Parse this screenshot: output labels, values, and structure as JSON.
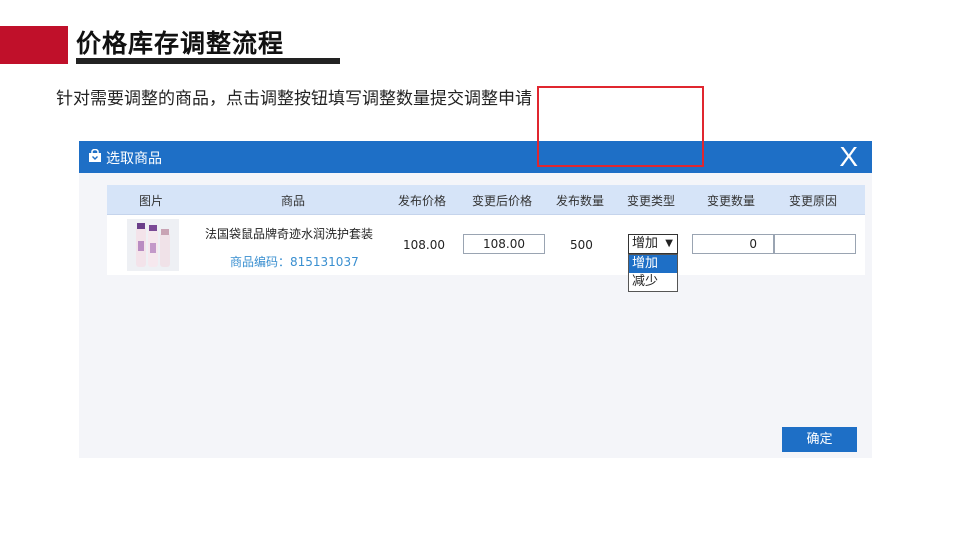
{
  "slide": {
    "title": "价格库存调整流程",
    "subtitle": "针对需要调整的商品，点击调整按钮填写调整数量提交调整申请"
  },
  "dialog": {
    "title": "选取商品",
    "close_label": "X",
    "confirm_label": "确定"
  },
  "table": {
    "headers": [
      "图片",
      "商品",
      "发布价格",
      "变更后价格",
      "发布数量",
      "变更类型",
      "变更数量",
      "变更原因"
    ],
    "row": {
      "product_name": "法国袋鼠品牌奇迹水润洗护套装",
      "product_code": "商品编码：815131037",
      "price": "108.00",
      "new_price": "108.00",
      "quantity": "500",
      "change_type": "增加",
      "change_qty": "0",
      "reason": ""
    },
    "change_type_options": [
      "增加",
      "减少"
    ]
  },
  "colors": {
    "accent_red": "#c0102a",
    "dialog_blue": "#1e6fc6",
    "highlight_red": "#e0262f",
    "code_blue": "#3a8fd0"
  }
}
